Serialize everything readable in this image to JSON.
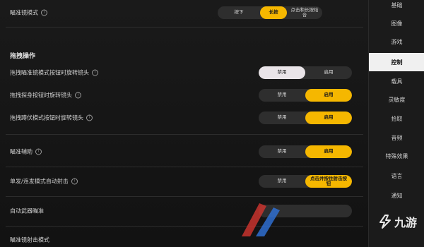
{
  "settings": {
    "top_row": {
      "label": "瞄准镜模式",
      "options": [
        "按下",
        "长按",
        "点击和长按结合"
      ],
      "selected": 1
    },
    "section_title": "拖拽操作",
    "rows": [
      {
        "label": "拖拽瞄准镜模式按钮时旋转镜头",
        "options": [
          "禁用",
          "启用"
        ],
        "selected": 0,
        "style": "white"
      },
      {
        "label": "拖拽探身按钮时旋转镜头",
        "options": [
          "禁用",
          "启用"
        ],
        "selected": 1,
        "style": "yellow"
      },
      {
        "label": "拖拽蹲伏模式按钮时旋转镜头",
        "options": [
          "禁用",
          "启用"
        ],
        "selected": 1,
        "style": "yellow"
      },
      {
        "label": "瞄准辅助",
        "options": [
          "禁用",
          "启用"
        ],
        "selected": 1,
        "style": "yellow"
      },
      {
        "label": "单发/连发模式自动射击",
        "options": [
          "禁用",
          "点击并按住射击按钮"
        ],
        "selected": 1,
        "style": "yellow"
      },
      {
        "label": "自动武器瞄准",
        "options": [],
        "selected": -1,
        "style": "none"
      },
      {
        "label": "瞄准镜射击模式",
        "options": [],
        "selected": -1,
        "style": "none"
      }
    ]
  },
  "sidebar": {
    "items": [
      "基础",
      "图像",
      "游戏",
      "控制",
      "载具",
      "灵敏度",
      "拾取",
      "音频",
      "特殊效果",
      "语言",
      "通知"
    ],
    "active_index": 3
  },
  "watermark": {
    "text": "九游"
  },
  "colors": {
    "accent": "#f5b700",
    "background": "#141414",
    "sidebar_active": "#f0f0f0"
  }
}
